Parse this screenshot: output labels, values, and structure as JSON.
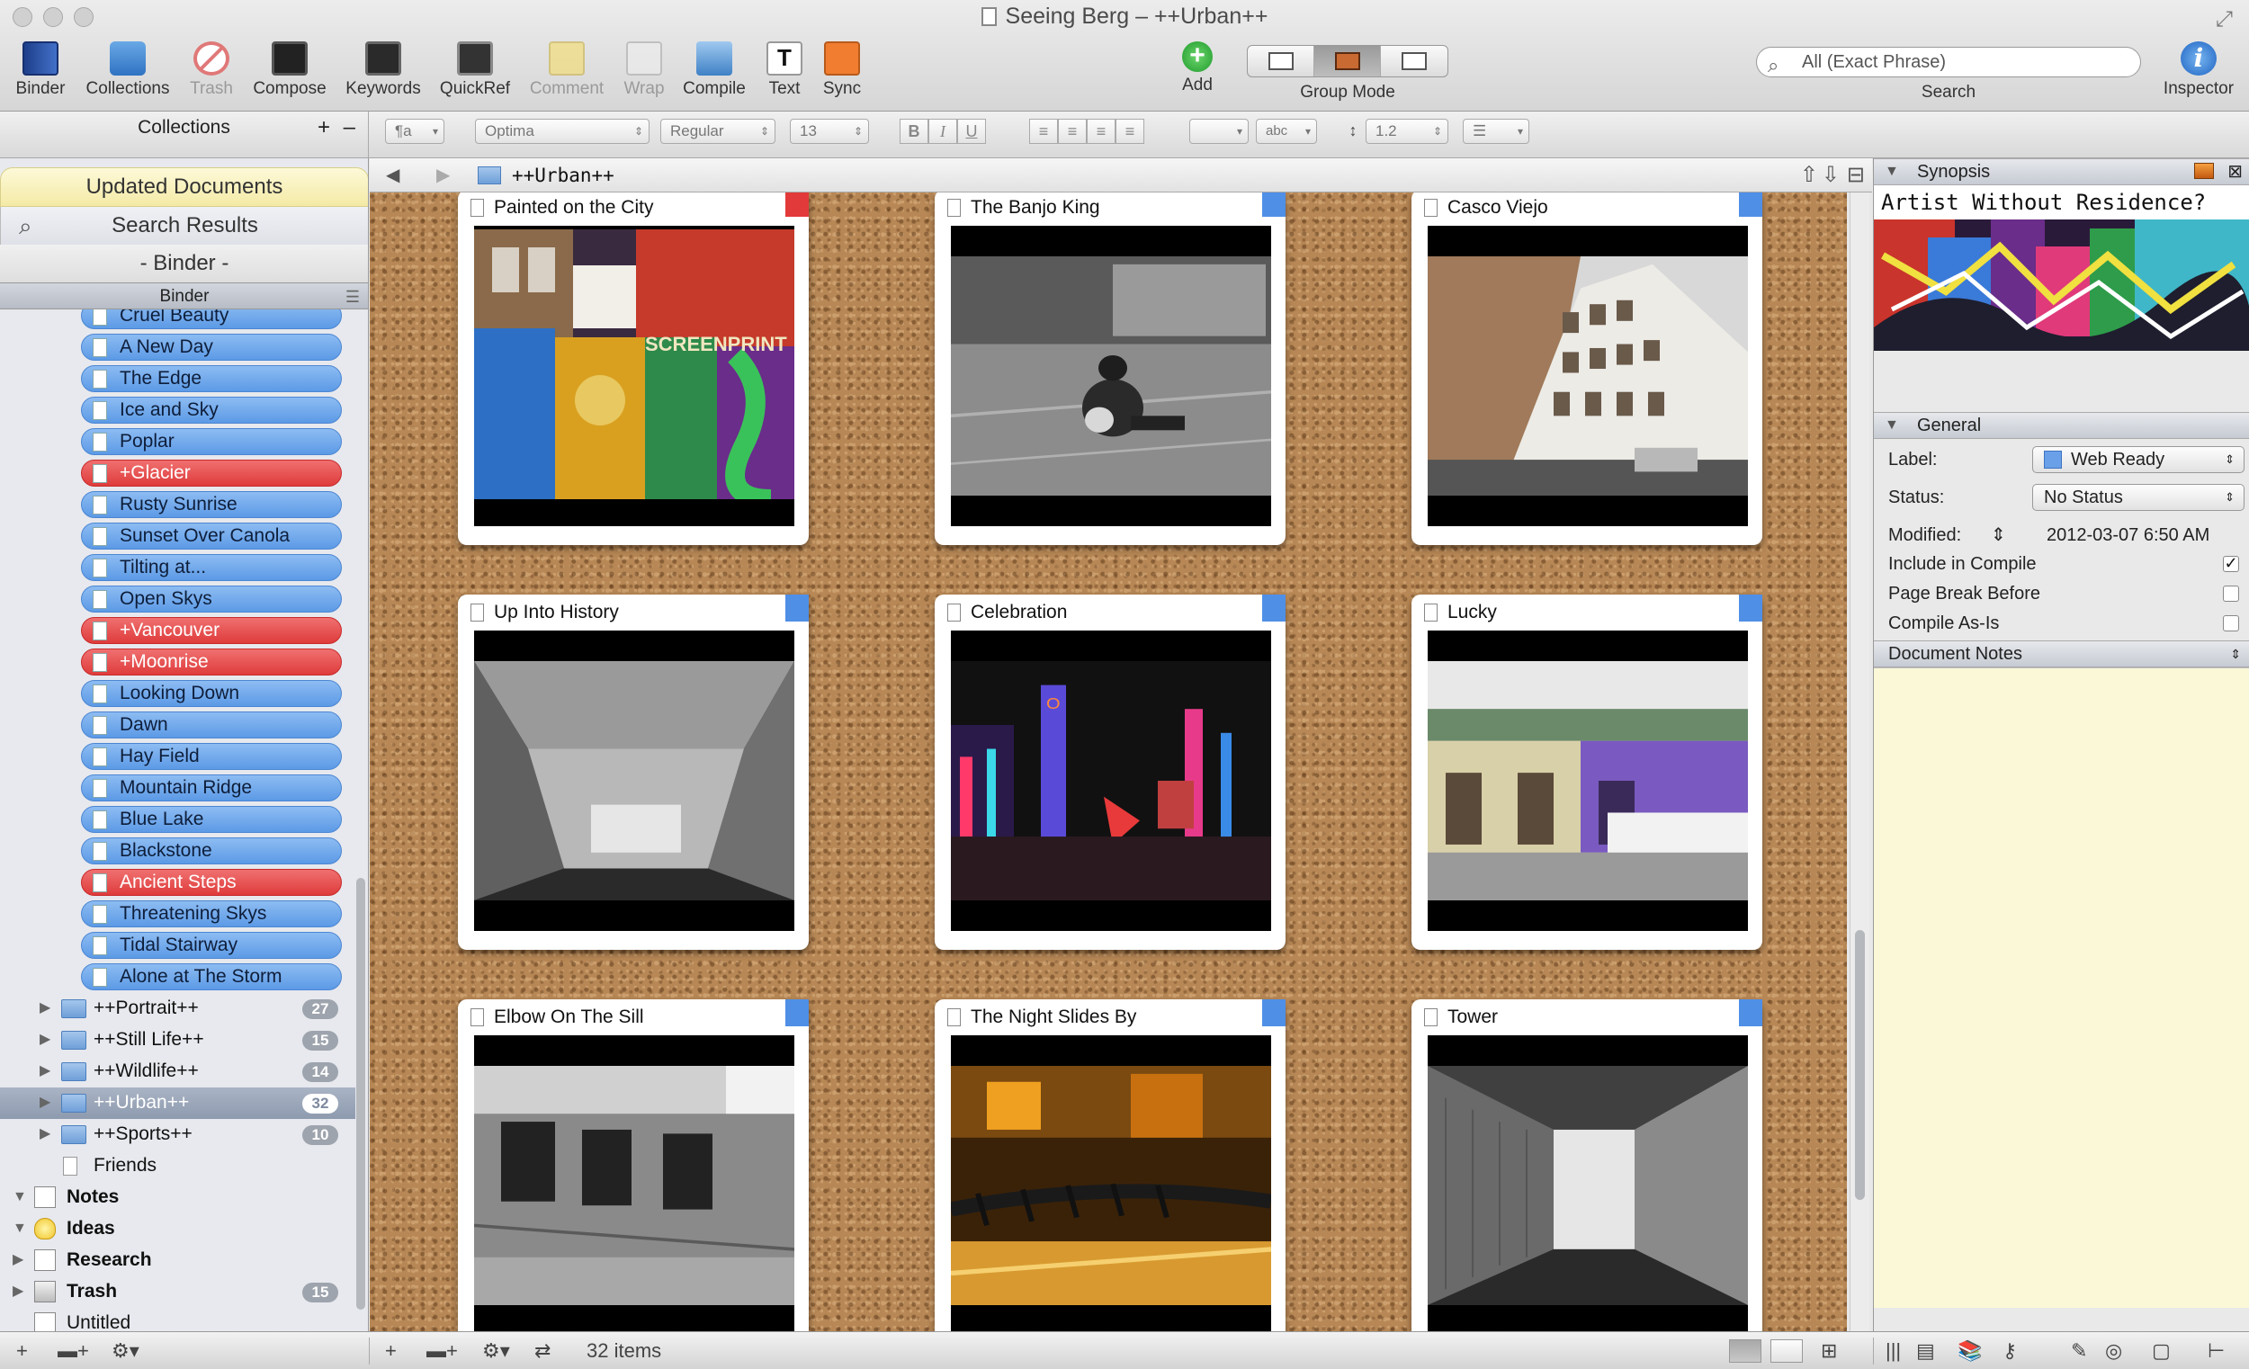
{
  "window": {
    "title": "Seeing Berg – ++Urban++"
  },
  "toolbar": {
    "binder": "Binder",
    "collections": "Collections",
    "trash": "Trash",
    "compose": "Compose",
    "keywords": "Keywords",
    "quickref": "QuickRef",
    "comment": "Comment",
    "wrap": "Wrap",
    "compile": "Compile",
    "text": "Text",
    "sync": "Sync",
    "add": "Add",
    "group_mode": "Group Mode",
    "search_label": "Search",
    "search_placeholder": "All (Exact Phrase)",
    "inspector": "Inspector",
    "text_icon_glyph": "T"
  },
  "format_bar": {
    "collections_header": "Collections",
    "paragraph_style": "¶a",
    "font": "Optima",
    "typeface": "Regular",
    "size": "13",
    "bold": "B",
    "italic": "I",
    "underline": "U",
    "line_spacing": "1.2",
    "highlight_text": "abc"
  },
  "sidebar": {
    "updated_documents": "Updated Documents",
    "search_results": "Search Results",
    "binder_tab": "- Binder -",
    "binder_header": "Binder",
    "docs": [
      {
        "label": "Cruel Beauty",
        "color": "blue"
      },
      {
        "label": "A New Day",
        "color": "blue"
      },
      {
        "label": "The Edge",
        "color": "blue"
      },
      {
        "label": "Ice and Sky",
        "color": "blue"
      },
      {
        "label": "Poplar",
        "color": "blue"
      },
      {
        "label": "+Glacier",
        "color": "red"
      },
      {
        "label": "Rusty Sunrise",
        "color": "blue"
      },
      {
        "label": "Sunset Over Canola",
        "color": "blue"
      },
      {
        "label": "Tilting at...",
        "color": "blue"
      },
      {
        "label": "Open Skys",
        "color": "blue"
      },
      {
        "label": "+Vancouver",
        "color": "red"
      },
      {
        "label": "+Moonrise",
        "color": "red"
      },
      {
        "label": "Looking Down",
        "color": "blue"
      },
      {
        "label": "Dawn",
        "color": "blue"
      },
      {
        "label": "Hay Field",
        "color": "blue"
      },
      {
        "label": "Mountain Ridge",
        "color": "blue"
      },
      {
        "label": "Blue Lake",
        "color": "blue"
      },
      {
        "label": "Blackstone",
        "color": "blue"
      },
      {
        "label": "Ancient Steps",
        "color": "red"
      },
      {
        "label": "Threatening Skys",
        "color": "blue"
      },
      {
        "label": "Tidal Stairway",
        "color": "blue"
      },
      {
        "label": "Alone at The Storm",
        "color": "blue"
      }
    ],
    "folders": [
      {
        "label": "++Portrait++",
        "count": "27"
      },
      {
        "label": "++Still Life++",
        "count": "15"
      },
      {
        "label": "++Wildlife++",
        "count": "14"
      },
      {
        "label": "++Urban++",
        "count": "32",
        "selected": true
      },
      {
        "label": "++Sports++",
        "count": "10"
      }
    ],
    "friends": "Friends",
    "top_level": [
      {
        "label": "Notes",
        "icon": "notes-icon",
        "count": ""
      },
      {
        "label": "Ideas",
        "icon": "lightbulb-icon",
        "count": ""
      },
      {
        "label": "Research",
        "icon": "research-icon",
        "count": ""
      },
      {
        "label": "Trash",
        "icon": "trash-icon",
        "count": "15"
      },
      {
        "label": "Untitled",
        "icon": "document-icon",
        "count": ""
      }
    ]
  },
  "corkboard": {
    "path": "++Urban++",
    "cards": [
      {
        "title": "Painted on the City",
        "label_color": "#e23a3a",
        "photo": "graffiti"
      },
      {
        "title": "The Banjo King",
        "label_color": "#4f8fe6",
        "photo": "banjo"
      },
      {
        "title": "Casco Viejo",
        "label_color": "#4f8fe6",
        "photo": "casco"
      },
      {
        "title": "Up Into History",
        "label_color": "#4f8fe6",
        "photo": "history"
      },
      {
        "title": "Celebration",
        "label_color": "#4f8fe6",
        "photo": "celebration"
      },
      {
        "title": "Lucky",
        "label_color": "#4f8fe6",
        "photo": "lucky"
      },
      {
        "title": "Elbow On The Sill",
        "label_color": "#4f8fe6",
        "photo": "sill"
      },
      {
        "title": "The Night Slides By",
        "label_color": "#4f8fe6",
        "photo": "night"
      },
      {
        "title": "Tower",
        "label_color": "#4f8fe6",
        "photo": "tower"
      }
    ]
  },
  "inspector": {
    "synopsis_header": "Synopsis",
    "synopsis_title": "Artist Without Residence?",
    "general_header": "General",
    "label_label": "Label:",
    "label_value": "Web Ready",
    "status_label": "Status:",
    "status_value": "No Status",
    "modified_label": "Modified:",
    "modified_value": "2012-03-07 6:50 AM",
    "include_compile": "Include in Compile",
    "page_break": "Page Break Before",
    "compile_as_is": "Compile As-Is",
    "notes_header": "Document Notes"
  },
  "footer": {
    "items_count": "32 items"
  },
  "colors": {
    "label_blue": "#5c9ae6",
    "label_red": "#df3b3b",
    "cork": "#b78755",
    "notes_bg": "#fbf8d8"
  }
}
